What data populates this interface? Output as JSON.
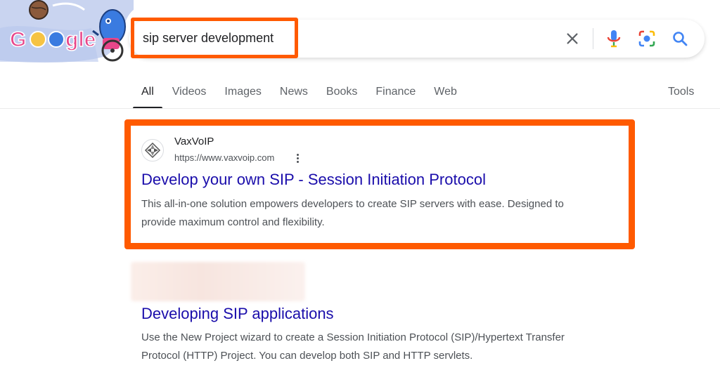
{
  "search": {
    "query": "sip server development",
    "logo_text": "Google"
  },
  "icons": {
    "clear": "close-icon",
    "voice": "microphone-icon",
    "lens": "camera-lens-icon",
    "search": "search-icon"
  },
  "tabs": [
    {
      "label": "All",
      "active": true
    },
    {
      "label": "Videos"
    },
    {
      "label": "Images"
    },
    {
      "label": "News"
    },
    {
      "label": "Books"
    },
    {
      "label": "Finance"
    },
    {
      "label": "Web"
    }
  ],
  "tools_label": "Tools",
  "results": [
    {
      "site_name": "VaxVoIP",
      "url": "https://www.vaxvoip.com",
      "title": "Develop your own SIP - Session Initiation Protocol",
      "snippet_line1": "This all-in-one solution empowers developers to create SIP servers with ease. Designed to",
      "snippet_line2": "provide maximum control and flexibility."
    },
    {
      "title": "Developing SIP applications",
      "snippet_line1": "Use the New Project wizard to create a Session Initiation Protocol (SIP)/Hypertext Transfer",
      "snippet_line2": "Protocol (HTTP) Project. You can develop both SIP and HTTP servlets."
    }
  ],
  "colors": {
    "highlight": "#ff5a00",
    "link": "#1a0dab",
    "snippet": "#4d5156"
  }
}
